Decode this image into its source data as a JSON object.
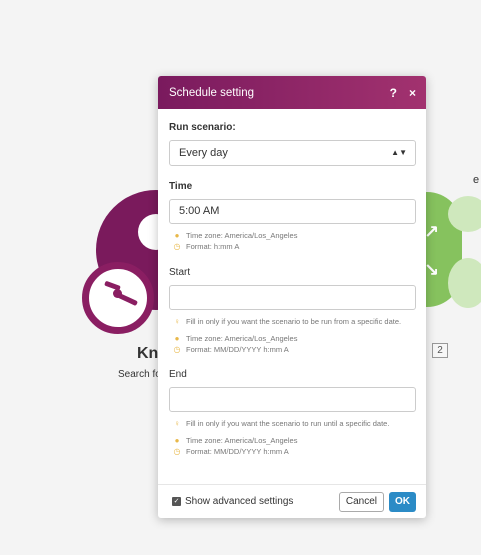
{
  "background": {
    "left_module": {
      "title": "Kn",
      "subtitle": "Search fo"
    },
    "right_module": {
      "corner_text": "e",
      "badge": "2"
    }
  },
  "dialog": {
    "title": "Schedule setting",
    "help_icon": "?",
    "close_icon": "×",
    "run_scenario": {
      "label": "Run scenario:",
      "value": "Every day"
    },
    "time": {
      "label": "Time",
      "value": "5:00 AM",
      "hints": [
        "Time zone: America/Los_Angeles",
        "Format: h:mm A"
      ]
    },
    "start": {
      "label": "Start",
      "value": "",
      "info": "Fill in only if you want the scenario to be run from a specific date.",
      "hints": [
        "Time zone: America/Los_Angeles",
        "Format: MM/DD/YYYY h:mm A"
      ]
    },
    "end": {
      "label": "End",
      "value": "",
      "info": "Fill in only if you want the scenario to run until a specific date.",
      "hints": [
        "Time zone: America/Los_Angeles",
        "Format: MM/DD/YYYY h:mm A"
      ]
    },
    "footer": {
      "advanced_label": "Show advanced settings",
      "advanced_checked": true,
      "cancel_label": "Cancel",
      "ok_label": "OK"
    }
  },
  "colors": {
    "header_start": "#7a1a5e",
    "header_end": "#a2326f",
    "ok_button": "#2b8bc6",
    "hint_icon": "#e8b84a",
    "module_purple": "#7a1a5c",
    "module_green": "#86c25e"
  },
  "icons": {
    "caret": "up-down-caret-icon",
    "hint_globe": "globe-icon",
    "hint_clock": "clock-icon",
    "hint_info": "lightbulb-icon",
    "checkbox": "checkmark-icon"
  }
}
